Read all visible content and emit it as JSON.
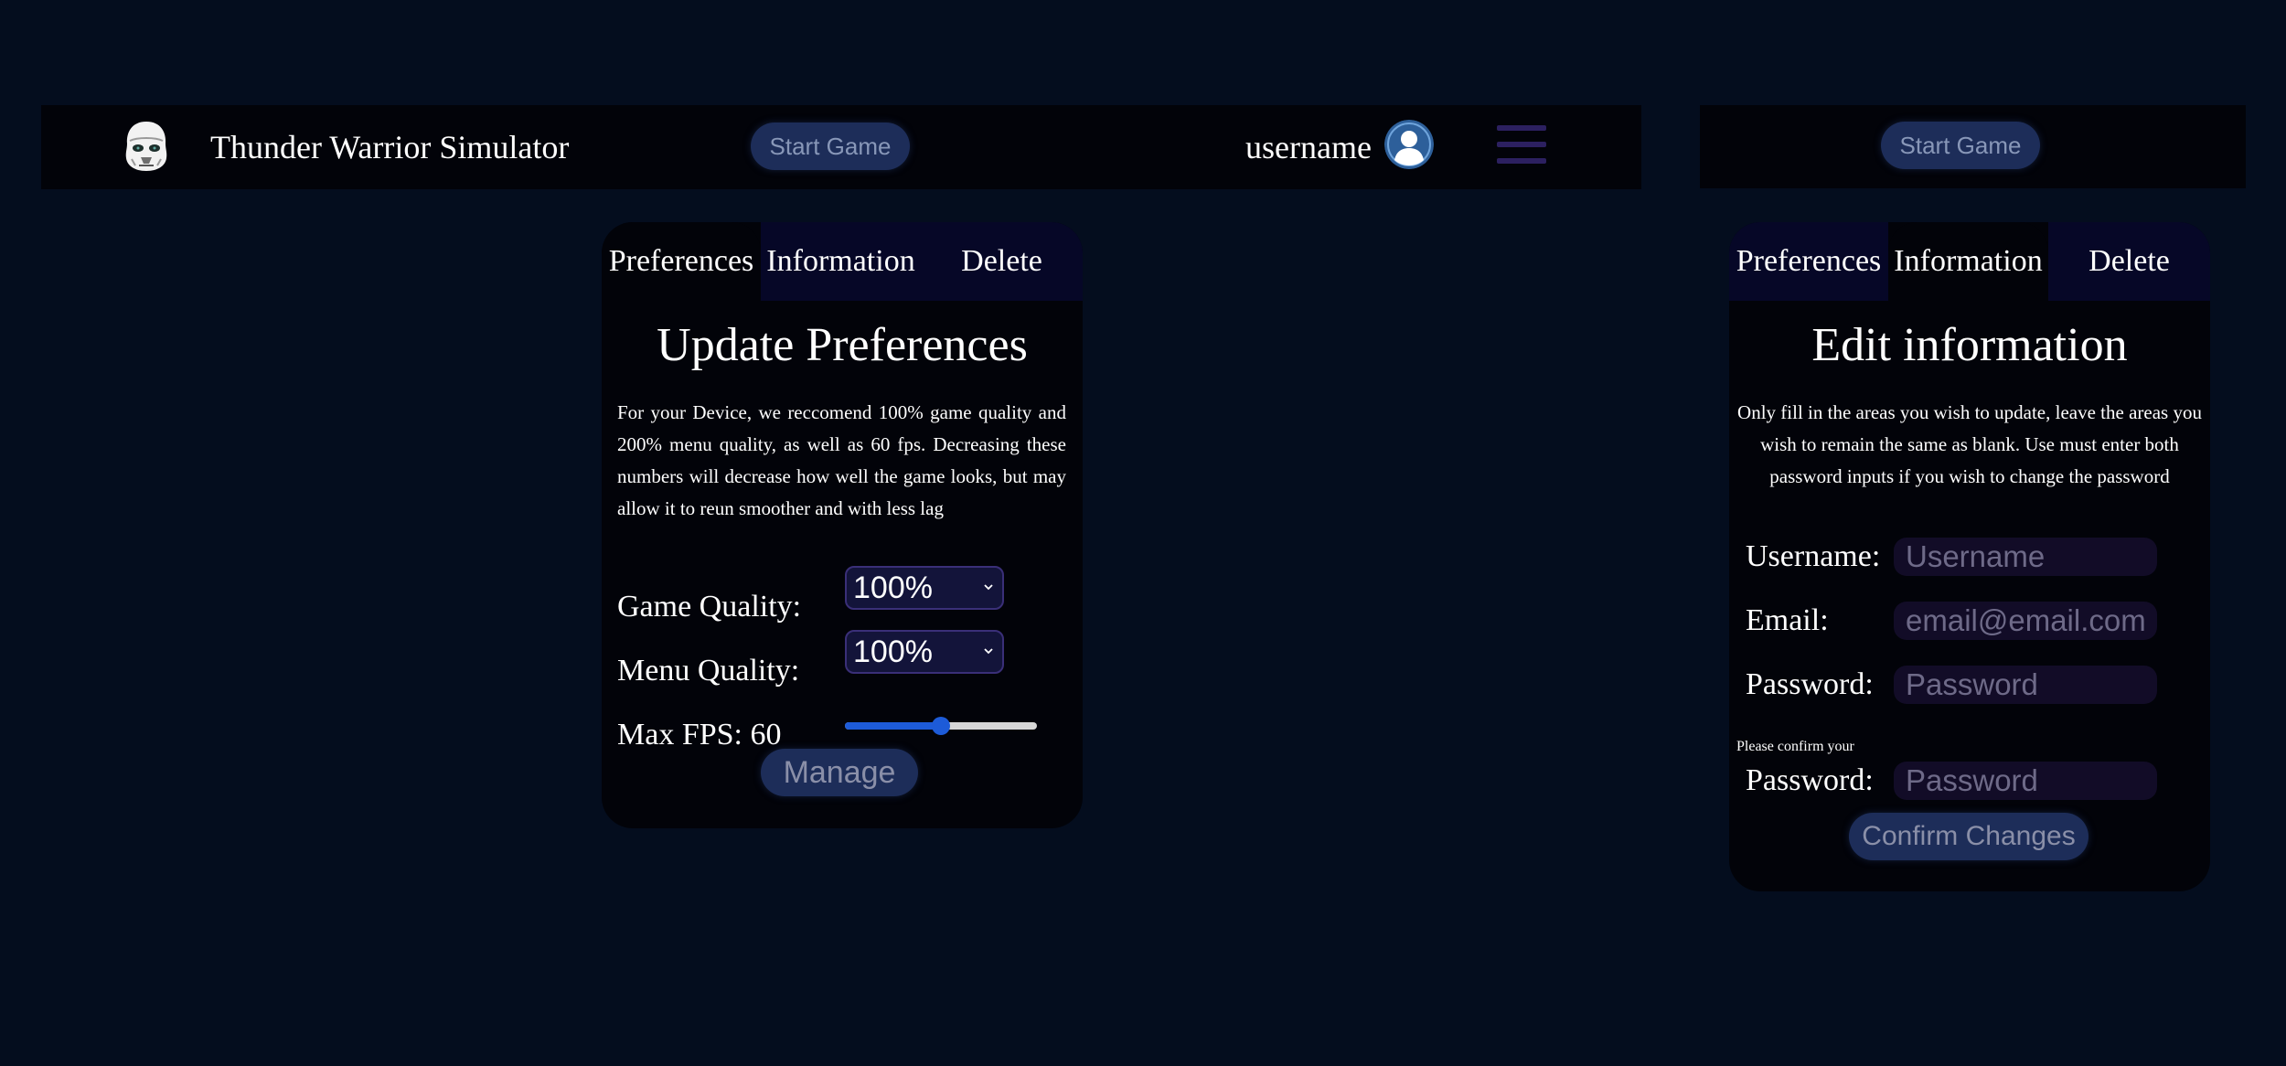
{
  "header": {
    "app_title": "Thunder Warrior Simulator",
    "start_game_label": "Start Game",
    "username": "username",
    "logo_icon": "stormtrooper-helmet-icon",
    "avatar_icon": "user-avatar-icon",
    "menu_icon": "hamburger-menu-icon"
  },
  "secondary_header": {
    "start_game_label": "Start Game"
  },
  "preferences_panel": {
    "tabs": [
      {
        "label": "Preferences",
        "active": true
      },
      {
        "label": "Information",
        "active": false
      },
      {
        "label": "Delete",
        "active": false
      }
    ],
    "heading": "Update Preferences",
    "description": "For your Device, we reccomend 100% game quality and 200% menu quality, as well as 60 fps. Decreasing these numbers will decrease how well the game looks, but may allow it to reun smoother and with less lag",
    "game_quality": {
      "label": "Game Quality:",
      "value": "100%"
    },
    "menu_quality": {
      "label": "Menu Quality:",
      "value": "100%"
    },
    "max_fps": {
      "label": "Max FPS: 60",
      "value": 60,
      "slider_fraction": 0.5
    },
    "manage_label": "Manage"
  },
  "information_panel": {
    "tabs": [
      {
        "label": "Preferences",
        "active": false
      },
      {
        "label": "Information",
        "active": true
      },
      {
        "label": "Delete",
        "active": false
      }
    ],
    "heading": "Edit information",
    "description": "Only fill in the areas you wish to update, leave the areas you wish to remain the same as blank. Use must enter both password inputs if you wish to change the password",
    "username": {
      "label": "Username:",
      "placeholder": "Username"
    },
    "email": {
      "label": "Email:",
      "placeholder": "email@email.com"
    },
    "password": {
      "label": "Password:",
      "placeholder": "Password"
    },
    "confirm_note": "Please confirm your",
    "confirm_password": {
      "label": "Password:",
      "placeholder": "Password"
    },
    "confirm_label": "Confirm Changes"
  },
  "colors": {
    "background": "#040d1e",
    "panel": "#020309",
    "inactive_tab": "#060727",
    "button": "#1d2d59",
    "slider_accent": "#1d5bd8",
    "menu_icon": "#2c2060"
  }
}
